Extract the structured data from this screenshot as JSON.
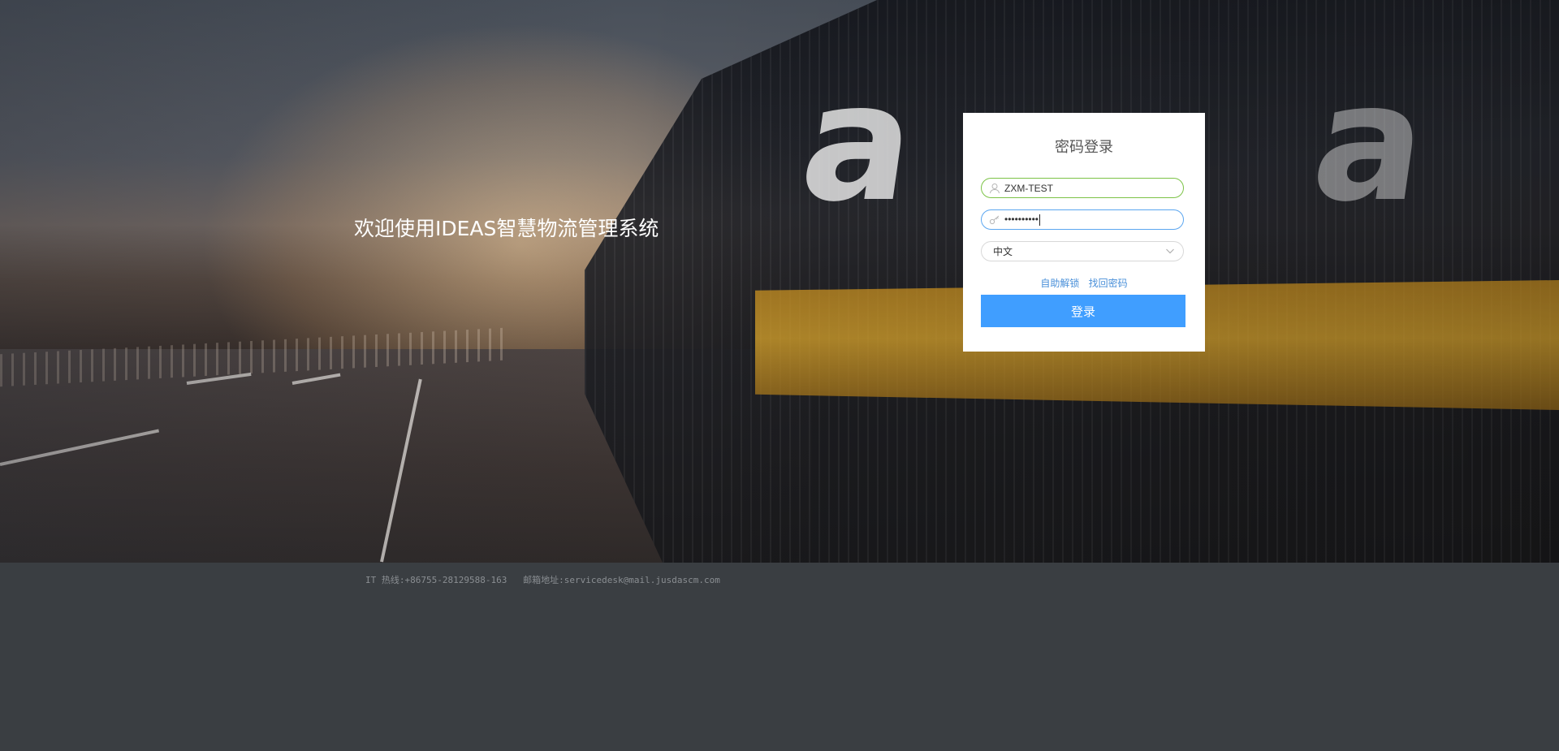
{
  "hero": {
    "welcome_text": "欢迎使用IDEAS智慧物流管理系统",
    "container_logo_letters_left": "a",
    "container_logo_letters_right": "a"
  },
  "login": {
    "title": "密码登录",
    "username_value": "ZXM-TEST",
    "password_value": "••••••••••",
    "language_value": "中文",
    "self_unlock_link": "自助解锁",
    "recover_password_link": "找回密码",
    "login_button": "登录"
  },
  "footer": {
    "text": "IT 热线:+86755-28129588-163   邮箱地址:servicedesk@mail.jusdascm.com"
  },
  "colors": {
    "primary_button": "#409eff",
    "username_border": "#7cc347",
    "password_border": "#5ba6f0",
    "link": "#4a90d9",
    "footer_bg": "#3a3e42"
  },
  "icons": [
    "user-icon",
    "key-icon",
    "chevron-down-icon"
  ]
}
